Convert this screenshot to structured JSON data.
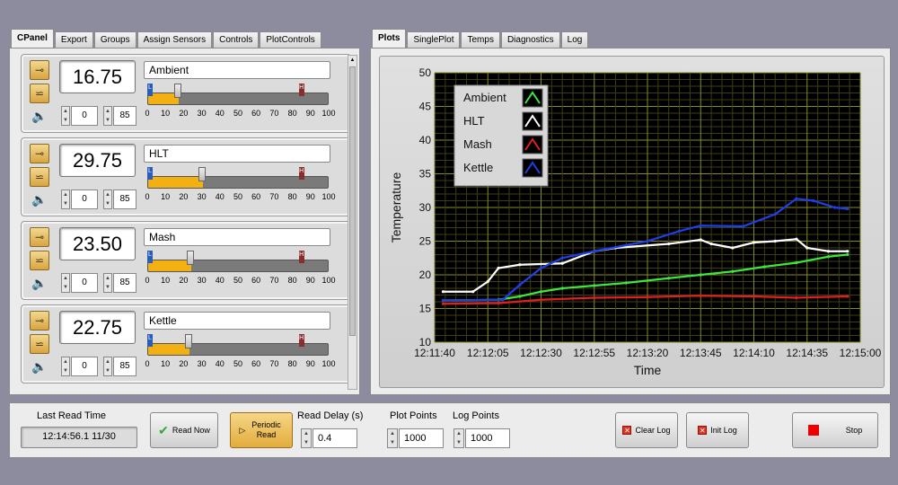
{
  "left_tabs": [
    "CPanel",
    "Export",
    "Groups",
    "Assign Sensors",
    "Controls",
    "PlotControls"
  ],
  "right_tabs": [
    "Plots",
    "SinglePlot",
    "Temps",
    "Diagnostics",
    "Log"
  ],
  "sensors": [
    {
      "name": "Ambient",
      "reading": "16.75",
      "low": "0",
      "high": "85",
      "level": 17
    },
    {
      "name": "HLT",
      "reading": "29.75",
      "low": "0",
      "high": "85",
      "level": 30
    },
    {
      "name": "Mash",
      "reading": "23.50",
      "low": "0",
      "high": "85",
      "level": 24
    },
    {
      "name": "Kettle",
      "reading": "22.75",
      "low": "0",
      "high": "85",
      "level": 23
    }
  ],
  "slider": {
    "scale": [
      "0",
      "10",
      "20",
      "30",
      "40",
      "50",
      "60",
      "70",
      "80",
      "90",
      "100"
    ],
    "low_marker": "L",
    "high_marker": "H"
  },
  "bottom": {
    "last_read_label": "Last Read Time",
    "last_read_value": "12:14:56.1 11/30",
    "read_now": "Read Now",
    "periodic_read": "Periodic Read",
    "read_delay_label": "Read Delay (s)",
    "read_delay_value": "0.4",
    "plot_points_label": "Plot Points",
    "plot_points_value": "1000",
    "log_points_label": "Log Points",
    "log_points_value": "1000",
    "clear_log": "Clear Log",
    "init_log": "Init Log",
    "stop": "Stop"
  },
  "chart_data": {
    "type": "line",
    "xlabel": "Time",
    "ylabel": "Temperature",
    "ylim": [
      10,
      50
    ],
    "yticks": [
      "10",
      "15",
      "20",
      "25",
      "30",
      "35",
      "40",
      "45",
      "50"
    ],
    "xticks": [
      "12:11:40",
      "12:12:05",
      "12:12:30",
      "12:12:55",
      "12:13:20",
      "12:13:45",
      "12:14:10",
      "12:14:35",
      "12:15:00"
    ],
    "x_range_seconds_from_12_11_40": [
      0,
      200
    ],
    "legend": [
      "Ambient",
      "HLT",
      "Mash",
      "Kettle"
    ],
    "legend_placement": "top-left",
    "grid": true,
    "series": [
      {
        "name": "Ambient",
        "color": "#3ee63e",
        "x": [
          "12:11:44",
          "12:12:10",
          "12:12:20",
          "12:12:30",
          "12:12:40",
          "12:12:55",
          "12:13:10",
          "12:13:30",
          "12:13:45",
          "12:14:00",
          "12:14:15",
          "12:14:30",
          "12:14:45",
          "12:14:54"
        ],
        "values": [
          16.2,
          16.3,
          16.8,
          17.5,
          18.0,
          18.4,
          18.8,
          19.5,
          20.0,
          20.5,
          21.2,
          21.8,
          22.7,
          23.0
        ]
      },
      {
        "name": "HLT",
        "color": "#ffffff",
        "x": [
          "12:11:44",
          "12:11:58",
          "12:12:05",
          "12:12:10",
          "12:12:20",
          "12:12:40",
          "12:12:55",
          "12:13:05",
          "12:13:30",
          "12:13:45",
          "12:13:50",
          "12:14:00",
          "12:14:10",
          "12:14:20",
          "12:14:30",
          "12:14:35",
          "12:14:45",
          "12:14:54"
        ],
        "values": [
          17.5,
          17.5,
          19.0,
          21.0,
          21.5,
          21.7,
          23.5,
          24.0,
          24.6,
          25.2,
          24.6,
          24.0,
          24.8,
          25.0,
          25.3,
          24.0,
          23.5,
          23.5
        ]
      },
      {
        "name": "Mash",
        "color": "#e02020",
        "x": [
          "12:11:44",
          "12:12:10",
          "12:12:30",
          "12:12:55",
          "12:13:20",
          "12:13:45",
          "12:14:10",
          "12:14:30",
          "12:14:54"
        ],
        "values": [
          15.7,
          15.8,
          16.3,
          16.6,
          16.7,
          16.9,
          16.8,
          16.6,
          16.8
        ]
      },
      {
        "name": "Kettle",
        "color": "#1f3fe8",
        "x": [
          "12:11:44",
          "12:12:12",
          "12:12:20",
          "12:12:30",
          "12:12:40",
          "12:12:55",
          "12:13:20",
          "12:13:35",
          "12:13:45",
          "12:14:05",
          "12:14:20",
          "12:14:30",
          "12:14:38",
          "12:14:48",
          "12:14:54"
        ],
        "values": [
          16.2,
          16.3,
          18.5,
          21.0,
          22.5,
          23.5,
          25.0,
          26.5,
          27.3,
          27.2,
          29.0,
          31.3,
          31.0,
          30.0,
          29.8
        ]
      }
    ]
  }
}
